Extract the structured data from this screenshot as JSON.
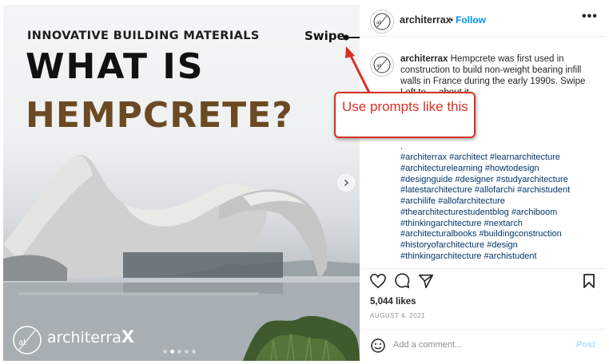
{
  "post_image": {
    "kicker": "INNOVATIVE BUILDING MATERIALS",
    "title_line1": "WHAT IS",
    "title_line2": "HEMPCRETE?",
    "swipe_label": "Swipe",
    "brand_text": "architerra",
    "brand_x": "X",
    "logo_text": "at",
    "carousel_dots": 5,
    "carousel_active_index": 1
  },
  "header": {
    "username": "architerrax",
    "separator": "•",
    "follow_label": "Follow",
    "more_label": "•••"
  },
  "caption": {
    "username": "architerrax",
    "text_visible": "Hempcrete was first used in construction to build non-weight bearing infill walls in France during the early 1990s. Swipe Left",
    "text_partial": "to ... about it.",
    "period": ".",
    "hashtags": [
      "#architerrax #architect #learnarchitecture",
      "#architecturelearning #howtodesign",
      "#designguide #designer #studyarchitecture",
      "#latestarchitecture #allofarchi #archistudent",
      "#archilife #allofarchitecture",
      "#thearchitecturestudentblog #archiboom",
      "#thinkingarchitecture #nextarch",
      "#architecturalbooks #buildingconstruction",
      "#historyofarchitecture #design",
      "#thinkingarchitecture #archistudent"
    ]
  },
  "stats": {
    "likes": "5,044 likes",
    "date": "AUGUST 4, 2021"
  },
  "comment": {
    "placeholder": "Add a comment...",
    "post_label": "Post"
  },
  "annotation": {
    "text": "Use prompts like this",
    "color": "#d93025"
  },
  "colors": {
    "follow_blue": "#0095f6",
    "hashtag_blue": "#00376b",
    "title_brown": "#6b4a23",
    "post_disabled": "#b2dffc"
  }
}
